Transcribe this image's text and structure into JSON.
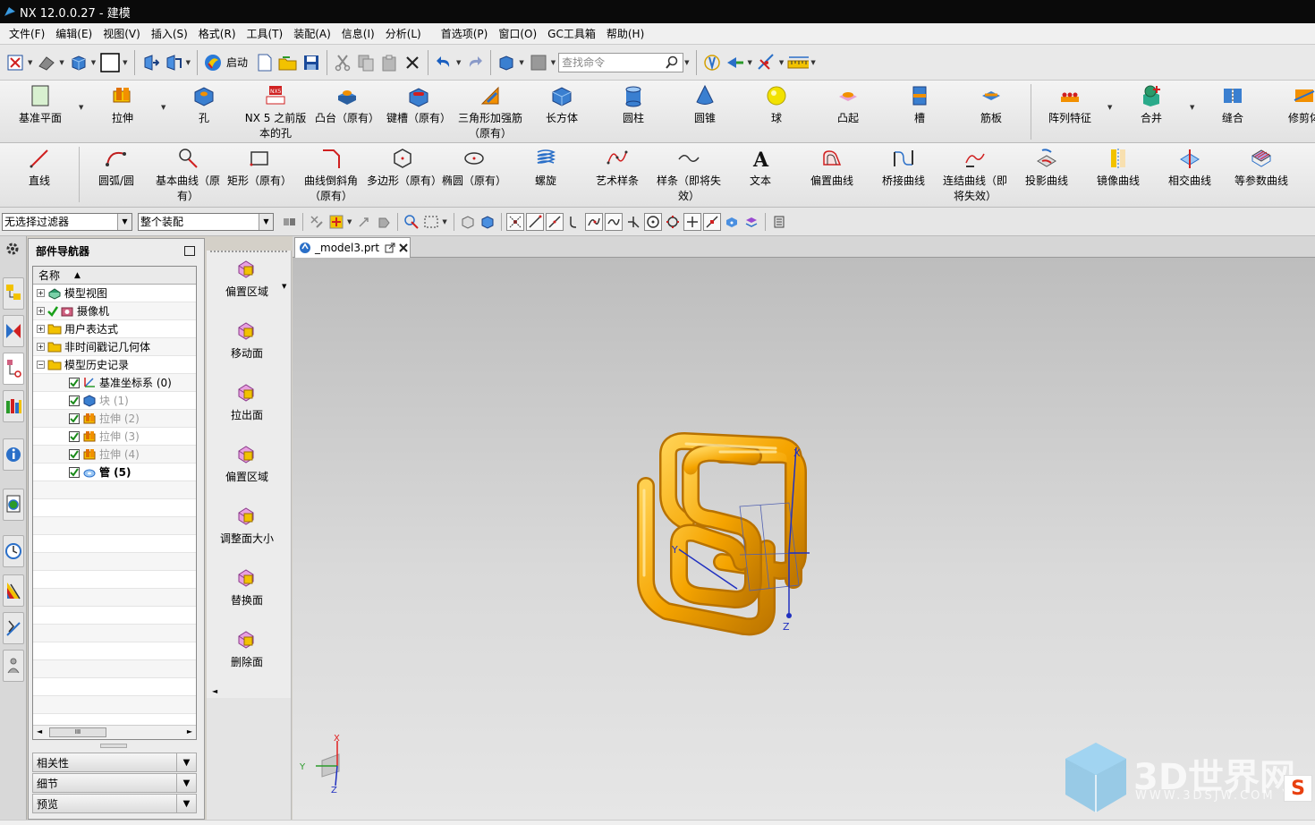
{
  "window": {
    "title": "NX 12.0.0.27 - 建模"
  },
  "menu": [
    "文件(F)",
    "编辑(E)",
    "视图(V)",
    "插入(S)",
    "格式(R)",
    "工具(T)",
    "装配(A)",
    "信息(I)",
    "分析(L)",
    "首选项(P)",
    "窗口(O)",
    "GC工具箱",
    "帮助(H)"
  ],
  "toolbar": {
    "start_label": "启动",
    "search_placeholder": "查找命令"
  },
  "ribbon_features": [
    {
      "label": "基准平面",
      "icon": "datum-plane-icon"
    },
    {
      "label": "拉伸",
      "icon": "extrude-icon"
    },
    {
      "label": "孔",
      "icon": "hole-icon"
    },
    {
      "label": "NX 5 之前版本的孔",
      "icon": "nx5-hole-icon",
      "badge": "NX5"
    },
    {
      "label": "凸台（原有）",
      "icon": "boss-icon"
    },
    {
      "label": "键槽（原有）",
      "icon": "slot-icon"
    },
    {
      "label": "三角形加强筋（原有）",
      "icon": "dart-icon"
    },
    {
      "label": "长方体",
      "icon": "block-icon"
    },
    {
      "label": "圆柱",
      "icon": "cylinder-icon"
    },
    {
      "label": "圆锥",
      "icon": "cone-icon"
    },
    {
      "label": "球",
      "icon": "sphere-icon"
    },
    {
      "label": "凸起",
      "icon": "emboss-icon"
    },
    {
      "label": "槽",
      "icon": "groove-icon"
    },
    {
      "label": "筋板",
      "icon": "rib-icon"
    },
    {
      "label": "阵列特征",
      "icon": "pattern-feature-icon"
    },
    {
      "label": "合并",
      "icon": "unite-icon"
    },
    {
      "label": "缝合",
      "icon": "sew-icon"
    },
    {
      "label": "修剪体",
      "icon": "trim-body-icon"
    }
  ],
  "ribbon_curves": [
    {
      "label": "直线",
      "icon": "line-icon"
    },
    {
      "label": "圆弧/圆",
      "icon": "arc-icon"
    },
    {
      "label": "基本曲线（原有）",
      "icon": "basic-curves-icon"
    },
    {
      "label": "矩形（原有）",
      "icon": "rectangle-icon"
    },
    {
      "label": "曲线倒斜角（原有）",
      "icon": "curve-chamfer-icon"
    },
    {
      "label": "多边形（原有）",
      "icon": "polygon-icon"
    },
    {
      "label": "椭圆（原有）",
      "icon": "ellipse-icon"
    },
    {
      "label": "螺旋",
      "icon": "helix-icon"
    },
    {
      "label": "艺术样条",
      "icon": "studio-spline-icon"
    },
    {
      "label": "样条（即将失效）",
      "icon": "spline-icon"
    },
    {
      "label": "文本",
      "icon": "text-icon"
    },
    {
      "label": "偏置曲线",
      "icon": "offset-curve-icon"
    },
    {
      "label": "桥接曲线",
      "icon": "bridge-curve-icon"
    },
    {
      "label": "连结曲线（即将失效）",
      "icon": "join-curves-icon"
    },
    {
      "label": "投影曲线",
      "icon": "project-curve-icon"
    },
    {
      "label": "镜像曲线",
      "icon": "mirror-curve-icon"
    },
    {
      "label": "相交曲线",
      "icon": "intersection-curve-icon"
    },
    {
      "label": "等参数曲线",
      "icon": "isoparametric-curve-icon"
    }
  ],
  "selection": {
    "filter": "无选择过滤器",
    "scope": "整个装配"
  },
  "navigator": {
    "title": "部件导航器",
    "column": "名称",
    "items": [
      {
        "label": "模型视图",
        "level": 0,
        "expand": "+",
        "icon": "model-views-icon"
      },
      {
        "label": "摄像机",
        "level": 0,
        "expand": "+",
        "icon": "camera-icon",
        "check": "green"
      },
      {
        "label": "用户表达式",
        "level": 0,
        "expand": "+",
        "icon": "folder-icon"
      },
      {
        "label": "非时间戳记几何体",
        "level": 0,
        "expand": "+",
        "icon": "folder-icon"
      },
      {
        "label": "模型历史记录",
        "level": 0,
        "expand": "-",
        "icon": "folder-icon"
      },
      {
        "label": "基准坐标系 (0)",
        "level": 1,
        "icon": "datum-csys-icon",
        "checked": true
      },
      {
        "label": "块 (1)",
        "level": 1,
        "icon": "block-feature-icon",
        "checked": true,
        "dim": true
      },
      {
        "label": "拉伸 (2)",
        "level": 1,
        "icon": "extrude-feature-icon",
        "checked": true,
        "dim": true
      },
      {
        "label": "拉伸 (3)",
        "level": 1,
        "icon": "extrude-feature-icon",
        "checked": true,
        "dim": true
      },
      {
        "label": "拉伸 (4)",
        "level": 1,
        "icon": "extrude-feature-icon",
        "checked": true,
        "dim": true
      },
      {
        "label": "管 (5)",
        "level": 1,
        "icon": "tube-feature-icon",
        "checked": true,
        "bold": true
      }
    ],
    "panels": [
      "相关性",
      "细节",
      "预览"
    ]
  },
  "face_commands": [
    "偏置区域",
    "移动面",
    "拉出面",
    "偏置区域",
    "调整面大小",
    "替换面",
    "删除面"
  ],
  "document_tab": "_model3.prt",
  "axes": {
    "x": "X",
    "y": "Y",
    "z": "Z"
  },
  "watermark": {
    "brand": "3D世界网",
    "url": "WWW.3DSJW.COM"
  },
  "colors": {
    "titlebar": "#0a0a0a",
    "tube": "#f5a400",
    "tube_dark": "#b87200",
    "axis_blue": "#2030c0",
    "axis_red": "#e02020"
  }
}
